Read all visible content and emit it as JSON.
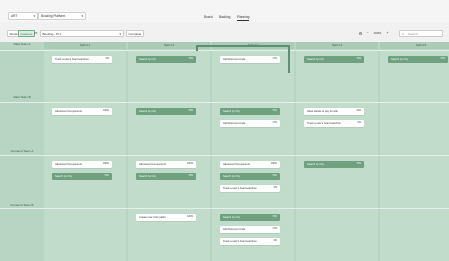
{
  "header": {
    "dropdown1": "ART",
    "dropdown2": "Booking Platform",
    "nav": [
      "Board",
      "Backlog",
      "Planning"
    ],
    "active_nav": "Planning"
  },
  "toolbar": {
    "stories": "Stories",
    "features": "Features",
    "pi_label": "PI",
    "pi_value": "Booking - PI 1",
    "complete": "Complete",
    "zoom": "100%",
    "search_placeholder": "Search"
  },
  "board": {
    "sprints": [
      "Sprint 1",
      "Sprint 2",
      "Sprint 3",
      "Sprint 4",
      "Sprint 5"
    ],
    "teams": [
      "Data Team A",
      "Data Team B",
      "Frontend Team A",
      "Frontend Team B"
    ],
    "cards": {
      "r0c0": [
        {
          "t": "Track a user's hotel searches",
          "p": "0%"
        }
      ],
      "r0c1": [
        {
          "t": "Search by City",
          "p": "76%"
        }
      ],
      "r0c2": [
        {
          "t": "Add Discount Code",
          "p": "17%"
        }
      ],
      "r0c3": [
        {
          "t": "Search by City",
          "p": "76%"
        }
      ],
      "r0c4": [
        {
          "t": "Search by City",
          "p": "76%"
        }
      ],
      "r1c0": [
        {
          "t": "Advanced Components",
          "p": "100%"
        }
      ],
      "r1c1": [
        {
          "t": "Search by City",
          "p": "76%"
        }
      ],
      "r1c2": [
        {
          "t": "Search by City",
          "p": "76%"
        },
        {
          "t": "Add Discount Code",
          "p": "17%"
        }
      ],
      "r1c3": [
        {
          "t": "Allow Hotels to pay for ads",
          "p": "34%"
        },
        {
          "t": "Track a user's hotel searches",
          "p": "0%"
        }
      ],
      "r2c0": [
        {
          "t": "Advanced Components",
          "p": "100%"
        },
        {
          "t": "Search by City",
          "p": "76%"
        }
      ],
      "r2c1": [
        {
          "t": "Advanced Components",
          "p": "100%"
        },
        {
          "t": "Search by City",
          "p": "76%"
        }
      ],
      "r2c2": [
        {
          "t": "Advanced Components",
          "p": "100%"
        },
        {
          "t": "Search by City",
          "p": "76%"
        },
        {
          "t": "Track a user's hotel searches",
          "p": "0%"
        }
      ],
      "r2c3": [
        {
          "t": "Search by City",
          "p": "76%"
        }
      ],
      "r3c1": [
        {
          "t": "Create new color pallet",
          "p": "100%"
        }
      ],
      "r3c2": [
        {
          "t": "Search by City",
          "p": "76%"
        },
        {
          "t": "Add Discount Code",
          "p": "17%"
        },
        {
          "t": "Track a user's hotel searches",
          "p": "0%"
        }
      ]
    }
  },
  "colors": {
    "board_bg": "#b8d5c3",
    "card_green": "#6fa080",
    "accent": "#2f7a4e"
  }
}
